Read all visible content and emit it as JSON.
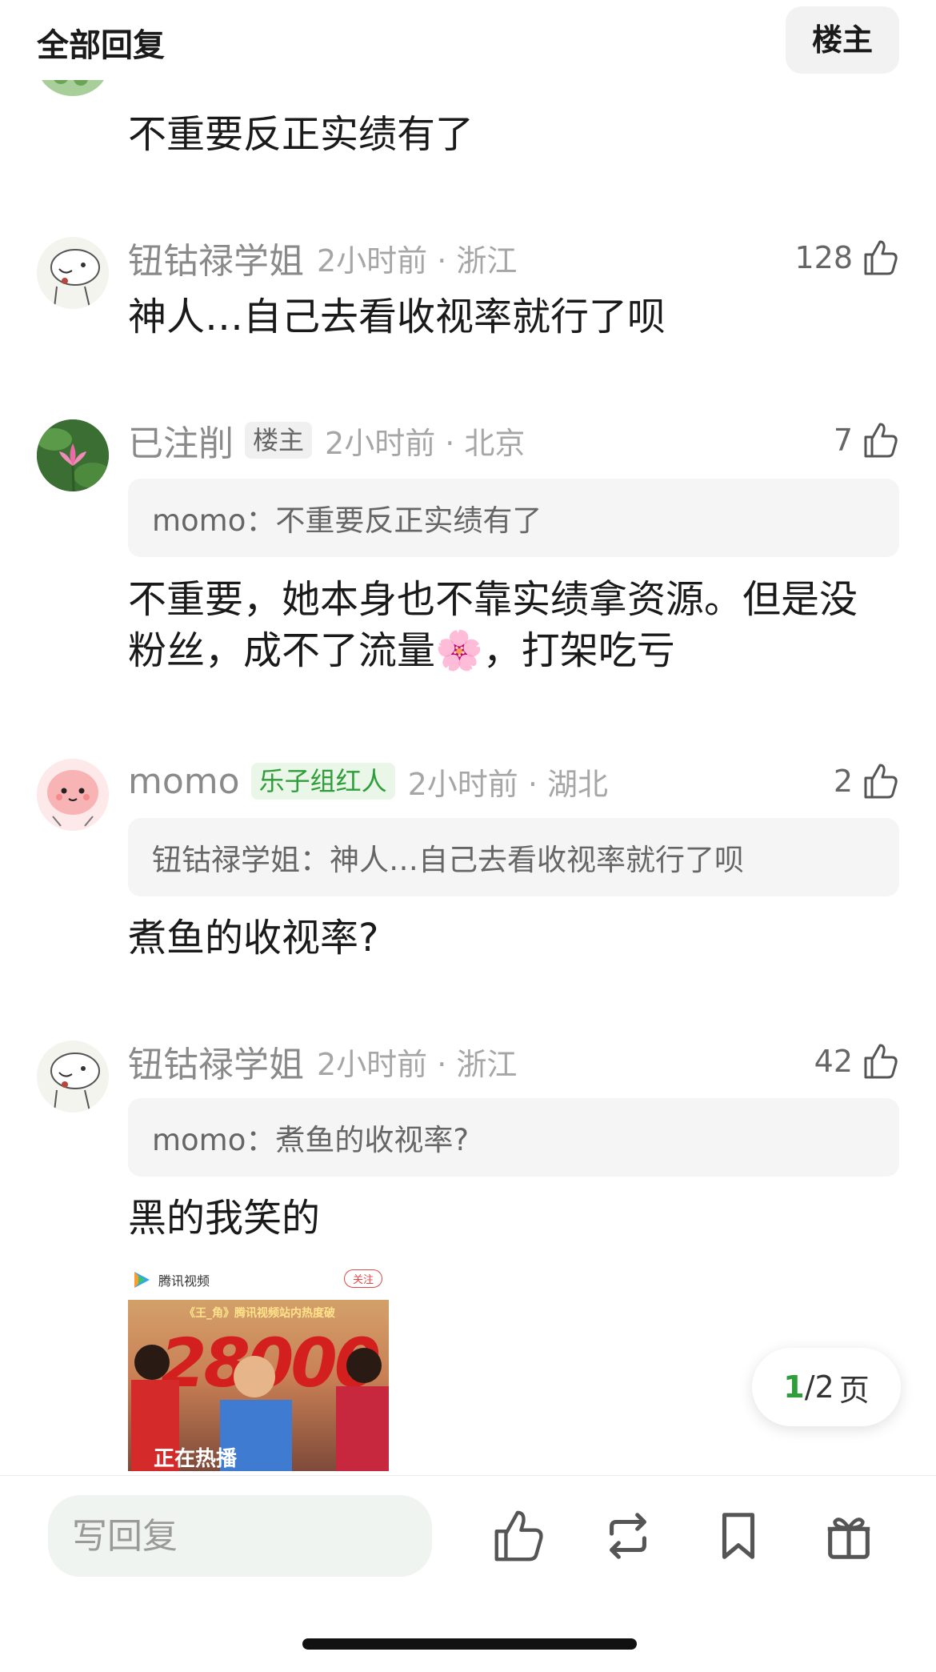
{
  "header": {
    "title": "全部回复",
    "op_filter": "楼主"
  },
  "comments": [
    {
      "text": "不重要反正实绩有了"
    },
    {
      "username": "钮钴禄学姐",
      "meta": "2小时前 · 浙江",
      "likes": "128",
      "text": "神人…自己去看收视率就行了呗"
    },
    {
      "username": "已注削",
      "tag": "楼主",
      "meta": "2小时前 · 北京",
      "likes": "7",
      "quote": "momo：不重要反正实绩有了",
      "text_line1": "不重要，她本身也不靠实绩拿资源。但是没",
      "text_line2": "粉丝，成不了流量",
      "emoji": "🌸",
      "text_line2_tail": "，打架吃亏"
    },
    {
      "username": "momo",
      "tag": "乐子组红人",
      "meta": "2小时前 · 湖北",
      "likes": "2",
      "quote": "钮钴禄学姐：神人…自己去看收视率就行了呗",
      "text": "煮鱼的收视率?"
    },
    {
      "username": "钮钴禄学姐",
      "meta": "2小时前 · 浙江",
      "likes": "42",
      "quote": "momo：煮鱼的收视率?",
      "text": "黑的我笑的",
      "image": {
        "app_name": "腾讯视频",
        "follow": "关注",
        "banner": "《王_角》腾讯视频站内热度破",
        "big_number": "28000",
        "caption": "正在热播"
      }
    }
  ],
  "pager": {
    "current": "1",
    "total": "/2",
    "unit": "页"
  },
  "bottom_bar": {
    "reply_placeholder": "写回复"
  },
  "colors": {
    "accent_green": "#2f9e3a",
    "muted": "#a6a6a6",
    "quote_bg": "#f5f5f5"
  }
}
